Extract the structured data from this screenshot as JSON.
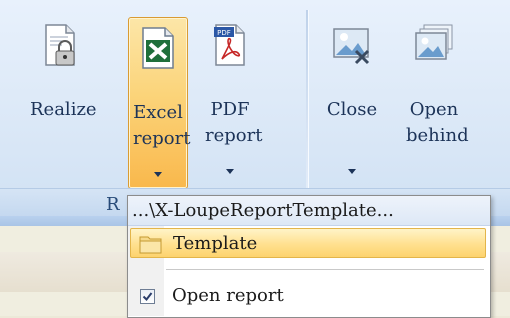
{
  "ribbon": {
    "buttons": [
      {
        "name": "realize-button",
        "icon": "realize-document-lock-icon",
        "label": "Realize"
      },
      {
        "name": "excel-report-button",
        "icon": "excel-icon",
        "label": "Excel report"
      },
      {
        "name": "pdf-report-button",
        "icon": "pdf-icon",
        "label": "PDF report"
      },
      {
        "name": "close-button",
        "icon": "close-image-icon",
        "label": "Close"
      },
      {
        "name": "open-behind-button",
        "icon": "open-behind-images-icon",
        "label": "Open behind"
      }
    ],
    "group_label": "R"
  },
  "dropdown": {
    "path_label": "...\\X-LoupeReportTemplate...",
    "template_item": "Template",
    "open_report_item": "Open report",
    "open_report_checked": true
  },
  "colors": {
    "highlight": "#fbd47a",
    "ribbon_bg": "#dbe8f7",
    "text": "#1c3358"
  }
}
